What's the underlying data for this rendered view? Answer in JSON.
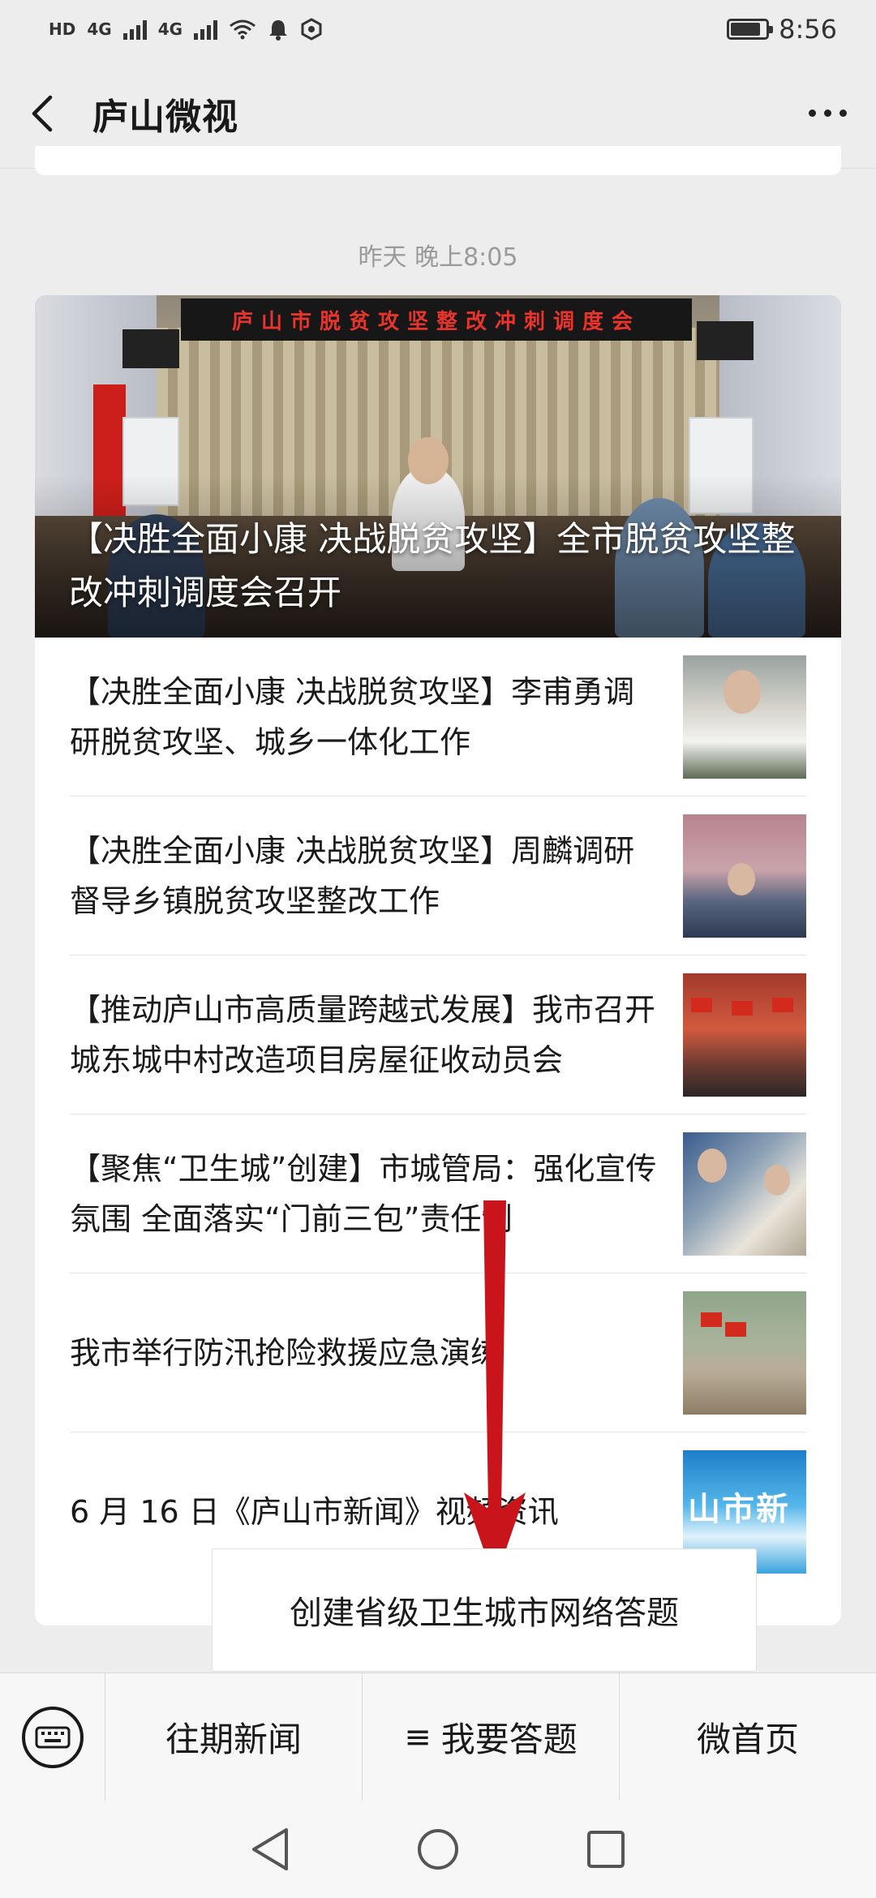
{
  "status_bar": {
    "left_labels": [
      "HD",
      "4G",
      "4G"
    ],
    "time": "8:56"
  },
  "nav": {
    "title": "庐山微视"
  },
  "timestamp": "昨天 晚上8:05",
  "hero": {
    "banner": "庐山市脱贫攻坚整改冲刺调度会",
    "title": "【决胜全面小康 决战脱贫攻坚】全市脱贫攻坚整改冲刺调度会召开"
  },
  "articles": [
    {
      "title": "【决胜全面小康 决战脱贫攻坚】李甫勇调研脱贫攻坚、城乡一体化工作",
      "thumb": "meeting-official-photo"
    },
    {
      "title": "【决胜全面小康 决战脱贫攻坚】周麟调研督导乡镇脱贫攻坚整改工作",
      "thumb": "meeting-room-photo"
    },
    {
      "title": "【推动庐山市高质量跨越式发展】我市召开城东城中村改造项目房屋征收动员会",
      "thumb": "assembly-hall-photo"
    },
    {
      "title": "【聚焦“卫生城”创建】市城管局：强化宣传氛围 全面落实“门前三包”责任制",
      "thumb": "officers-outdoor-photo"
    },
    {
      "title": "我市举行防汛抢险救援应急演练",
      "thumb": "flood-drill-photo"
    },
    {
      "title": "6 月 16 日《庐山市新闻》视频资讯",
      "thumb": "news-video-cover",
      "thumb_text": "山市新"
    }
  ],
  "popup": {
    "label": "创建省级卫生城市网络答题"
  },
  "menu": {
    "items": [
      {
        "label": "往期新闻",
        "prefix": ""
      },
      {
        "label": "我要答题",
        "prefix": "≡"
      },
      {
        "label": "微首页",
        "prefix": ""
      }
    ]
  },
  "colors": {
    "background": "#ededed",
    "arrow": "#c8141a",
    "banner_text": "#e8342a"
  }
}
